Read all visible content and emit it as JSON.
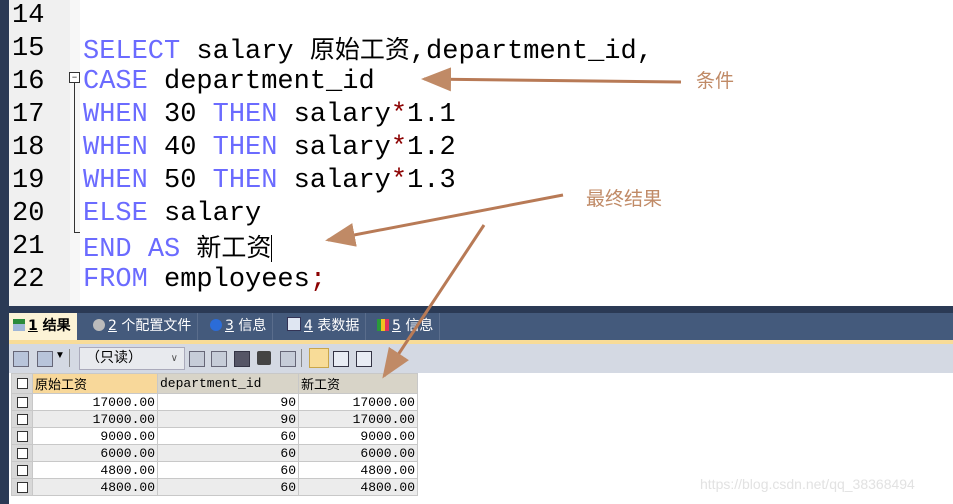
{
  "editor": {
    "lines": [
      {
        "num": "14",
        "tokens": []
      },
      {
        "num": "15",
        "tokens": [
          {
            "t": "SELECT",
            "c": "kw"
          },
          {
            "t": " salary ",
            "c": ""
          },
          {
            "t": "原始工资",
            "c": "cjk"
          },
          {
            "t": ",department_id,",
            "c": ""
          }
        ]
      },
      {
        "num": "16",
        "tokens": [
          {
            "t": "CASE",
            "c": "kw"
          },
          {
            "t": " department_id",
            "c": ""
          }
        ]
      },
      {
        "num": "17",
        "tokens": [
          {
            "t": "WHEN",
            "c": "kw"
          },
          {
            "t": " 30 ",
            "c": ""
          },
          {
            "t": "THEN",
            "c": "kw"
          },
          {
            "t": " salary",
            "c": ""
          },
          {
            "t": "*",
            "c": "op"
          },
          {
            "t": "1.1",
            "c": ""
          }
        ]
      },
      {
        "num": "18",
        "tokens": [
          {
            "t": "WHEN",
            "c": "kw"
          },
          {
            "t": " 40 ",
            "c": ""
          },
          {
            "t": "THEN",
            "c": "kw"
          },
          {
            "t": " salary",
            "c": ""
          },
          {
            "t": "*",
            "c": "op"
          },
          {
            "t": "1.2",
            "c": ""
          }
        ]
      },
      {
        "num": "19",
        "tokens": [
          {
            "t": "WHEN",
            "c": "kw"
          },
          {
            "t": " 50 ",
            "c": ""
          },
          {
            "t": "THEN",
            "c": "kw"
          },
          {
            "t": " salary",
            "c": ""
          },
          {
            "t": "*",
            "c": "op"
          },
          {
            "t": "1.3",
            "c": ""
          }
        ]
      },
      {
        "num": "20",
        "tokens": [
          {
            "t": "ELSE",
            "c": "kw"
          },
          {
            "t": " salary",
            "c": ""
          }
        ]
      },
      {
        "num": "21",
        "tokens": [
          {
            "t": "END",
            "c": "kw"
          },
          {
            "t": " ",
            "c": ""
          },
          {
            "t": "AS",
            "c": "kw"
          },
          {
            "t": " ",
            "c": ""
          },
          {
            "t": "新工资",
            "c": "cjk"
          }
        ]
      },
      {
        "num": "22",
        "tokens": [
          {
            "t": "FROM",
            "c": "kw"
          },
          {
            "t": " employees",
            "c": ""
          },
          {
            "t": ";",
            "c": "op"
          }
        ]
      }
    ]
  },
  "annotations": {
    "condition": "条件",
    "final_result": "最终结果"
  },
  "tabs": [
    {
      "num": "1",
      "label": "结果",
      "icon": "result-grid-icon",
      "active": true
    },
    {
      "num": "2",
      "label": "个配置文件",
      "icon": "profile-icon",
      "active": false
    },
    {
      "num": "3",
      "label": "信息",
      "icon": "info-icon",
      "active": false
    },
    {
      "num": "4",
      "label": "表数据",
      "icon": "table-data-icon",
      "active": false
    },
    {
      "num": "5",
      "label": "信息",
      "icon": "chart-info-icon",
      "active": false
    }
  ],
  "toolbar": {
    "mode_select": "（只读）"
  },
  "grid": {
    "columns": [
      "原始工资",
      "department_id",
      "新工资"
    ],
    "rows": [
      [
        "17000.00",
        "90",
        "17000.00"
      ],
      [
        "17000.00",
        "90",
        "17000.00"
      ],
      [
        "9000.00",
        "60",
        "9000.00"
      ],
      [
        "6000.00",
        "60",
        "6000.00"
      ],
      [
        "4800.00",
        "60",
        "4800.00"
      ],
      [
        "4800.00",
        "60",
        "4800.00"
      ]
    ]
  },
  "watermark": "https://blog.csdn.net/qq_38368494",
  "colors": {
    "keyword": "#6b6bff",
    "annotation": "#c08a66",
    "tabbar": "#445a7c",
    "active_tab": "#fcf3d6"
  }
}
